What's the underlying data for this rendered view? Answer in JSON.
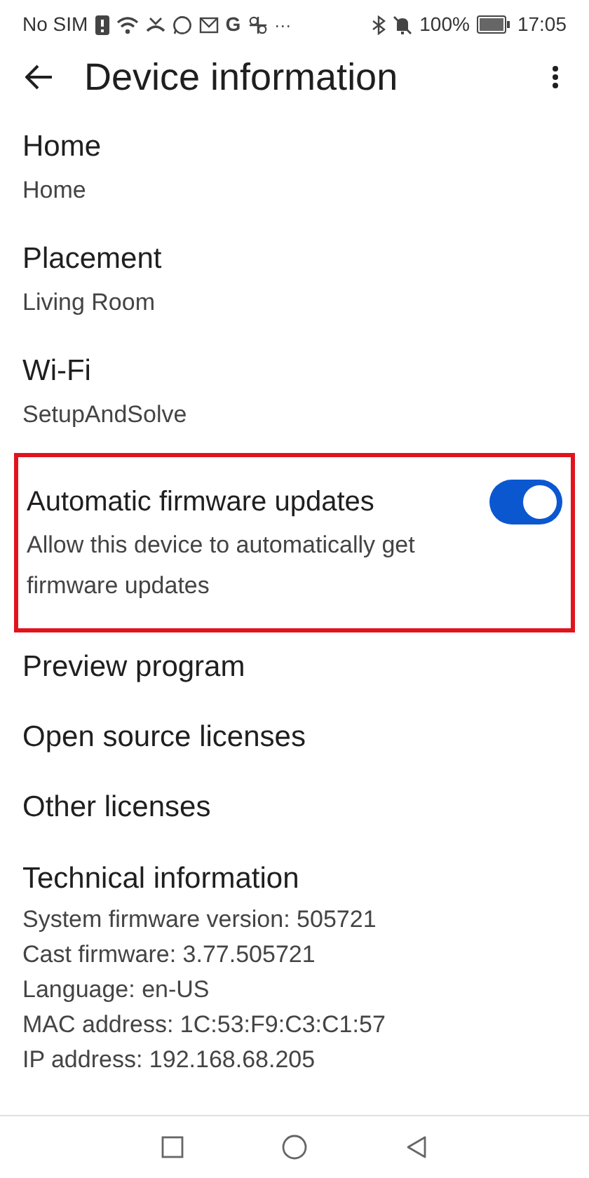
{
  "status_bar": {
    "carrier": "No SIM",
    "google_glyph": "G",
    "more": "···",
    "battery": "100%",
    "time": "17:05"
  },
  "header": {
    "title": "Device information"
  },
  "settings": [
    {
      "label": "Home",
      "value": "Home"
    },
    {
      "label": "Placement",
      "value": "Living Room"
    },
    {
      "label": "Wi-Fi",
      "value": "SetupAndSolve"
    }
  ],
  "firmware_toggle": {
    "label": "Automatic firmware updates",
    "description": "Allow this device to automatically get firmware updates",
    "on": true,
    "highlighted": true
  },
  "links": [
    "Preview program",
    "Open source licenses",
    "Other licenses"
  ],
  "technical_information": {
    "title": "Technical information",
    "lines": [
      "System firmware version: 505721",
      "Cast firmware: 3.77.505721",
      "Language: en-US",
      "MAC address: 1C:53:F9:C3:C1:57",
      "IP address: 192.168.68.205"
    ]
  }
}
